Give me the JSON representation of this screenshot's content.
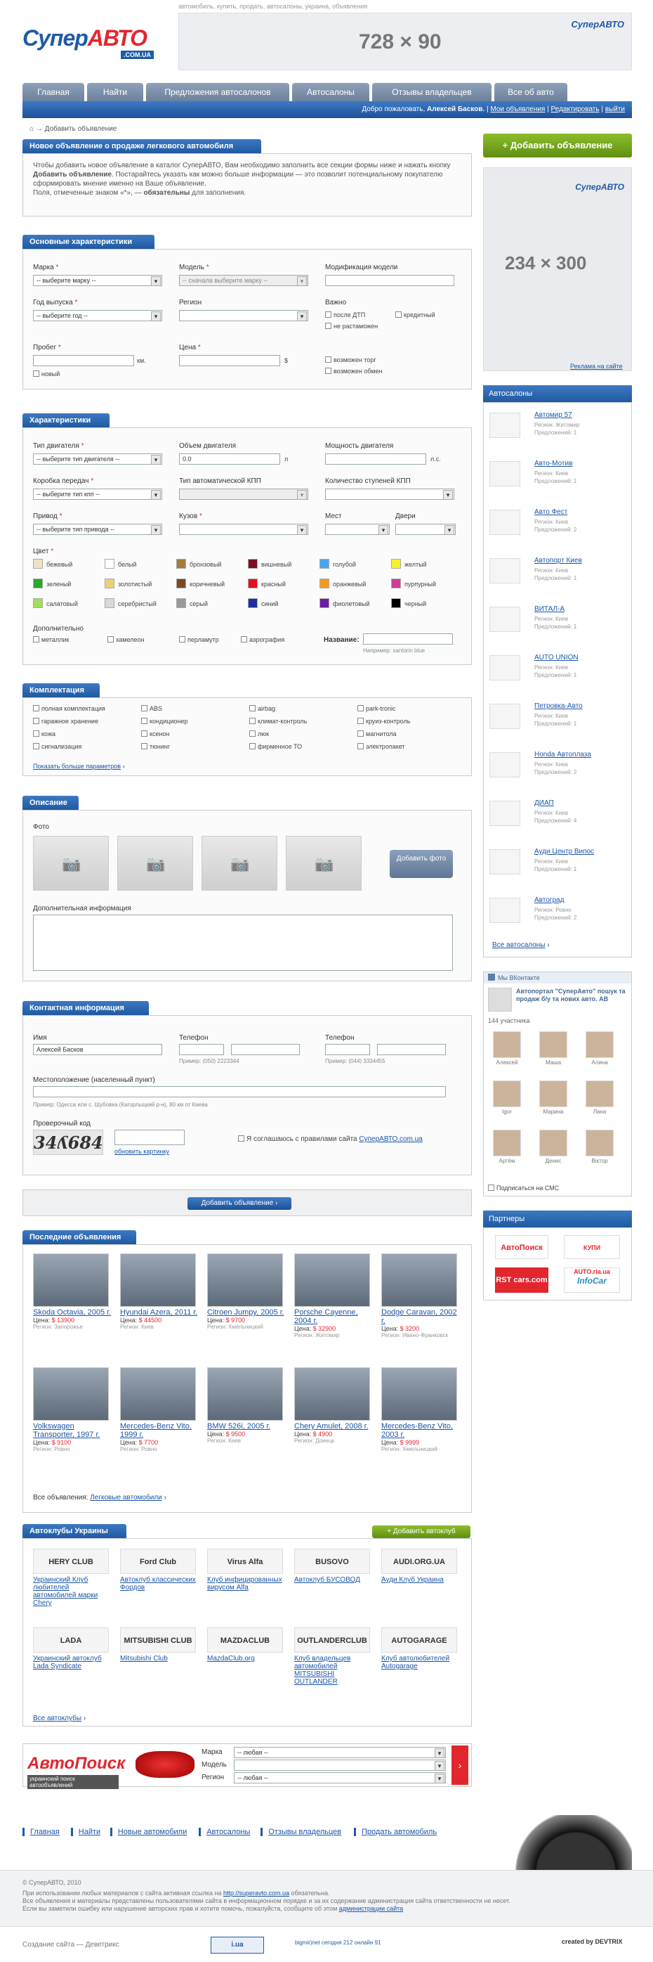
{
  "header": {
    "tagline": "автомобиль, купить, продать, автосалоны, украина, объявления",
    "logo_main": "Супер",
    "logo_accent": "АВТО",
    "logo_domain": ".COM.UA",
    "banner_size": "728 × 90",
    "banner_logo": "СуперАВТО"
  },
  "nav": {
    "tabs": [
      "Главная",
      "Найти",
      "Предложения автосалонов",
      "Автосалоны",
      "Отзывы владельцев",
      "Все об авто"
    ],
    "welcome": "Добро пожаловать,",
    "user": "Алексей Басков.",
    "my_ads": "Мои объявления",
    "edit": "Редактировать",
    "logout": "выйти"
  },
  "breadcrumb": "→ Добавить объявление",
  "intro": {
    "title": "Новое объявление о продаже легкового автомобиля",
    "text1": "Чтобы добавить новое объявление в каталог СуперАВТО, Вам необходимо заполнить все секции формы ниже и нажать кнопку",
    "button_ref": "Добавить объявление",
    "text2": ". Постарайтесь указать как можно больше информации — это позволит потенциальному покупателю сформировать мнение именно на Ваше объявление.",
    "text3": "Поля, отмеченные знаком «*», —",
    "text3b": "обязательны",
    "text3c": "для заполнения."
  },
  "sidebar_btn": "+ Добавить объявление",
  "ad_right": {
    "size": "234 × 300",
    "link": "Реклама на сайте"
  },
  "basic": {
    "title": "Основные характеристики",
    "brand": "Марка",
    "brand_val": "-- выберите марку --",
    "model": "Модель",
    "model_val": "-- сначала выберите марку --",
    "mod": "Модификация модели",
    "year": "Год выпуска",
    "year_val": "-- выберите год --",
    "region": "Регион",
    "important": "Важно",
    "imp": [
      "после ДТП",
      "кредитный",
      "не растаможен"
    ],
    "mileage": "Пробег",
    "km": "км.",
    "new": "новый",
    "price": "Цена",
    "usd": "$",
    "bargain": "возможен торг",
    "exchange": "возможен обмен"
  },
  "specs": {
    "title": "Характеристики",
    "body": "Тип двигателя",
    "body_val": "-- выберите тип двигателя --",
    "vol": "Объем двигателя",
    "vol_val": "0.0",
    "l": "л",
    "power": "Мощность двигателя",
    "hp": "л.с.",
    "gear": "Коробка передач",
    "gear_val": "-- выберите тип кпп --",
    "auto": "Тип автоматической КПП",
    "steps": "Количество ступеней КПП",
    "drive": "Привод",
    "drive_val": "-- выберите тип привода --",
    "kuzov": "Кузов",
    "seats": "Мест",
    "doors": "Двери",
    "color": "Цвет",
    "colors": [
      [
        "бежевый",
        "#efe3c4"
      ],
      [
        "белый",
        "#ffffff"
      ],
      [
        "бронзовый",
        "#a97b3c"
      ],
      [
        "вишневый",
        "#7a1020"
      ],
      [
        "голубой",
        "#4aa3f0"
      ],
      [
        "желтый",
        "#f6f12a"
      ],
      [
        "зеленый",
        "#2aa82a"
      ],
      [
        "золотистый",
        "#efd070"
      ],
      [
        "коричневый",
        "#7a4a20"
      ],
      [
        "красный",
        "#e3121e"
      ],
      [
        "оранжевый",
        "#f39a1e"
      ],
      [
        "пурпурный",
        "#d03b9a"
      ],
      [
        "салатовый",
        "#9fe05a"
      ],
      [
        "серебристый",
        "#d8d8d8"
      ],
      [
        "серый",
        "#999999"
      ],
      [
        "синий",
        "#1c2fa0"
      ],
      [
        "фиолетовый",
        "#6a1fa0"
      ],
      [
        "черный",
        "#000000"
      ]
    ],
    "extra": "Дополнительно",
    "extras": [
      "металлик",
      "хамелеон",
      "перламутр",
      "аэрография"
    ],
    "name": "Название:",
    "example": "Например: santorin blue"
  },
  "equip": {
    "title": "Комплектация",
    "items": [
      "полная комплектация",
      "ABS",
      "airbag",
      "park-tronic",
      "гаражное хранение",
      "кондиционер",
      "климат-контроль",
      "круиз-контроль",
      "кожа",
      "ксенон",
      "люк",
      "магнитола",
      "сигнализация",
      "тюнинг",
      "фирменное ТО",
      "электропакет"
    ],
    "more": "Показать больше параметров"
  },
  "desc": {
    "title": "Описание",
    "photo": "Фото",
    "add_photo": "Добавить фото",
    "info": "Дополнительная информация"
  },
  "contact": {
    "title": "Контактная информация",
    "name": "Имя",
    "name_val": "Алексей Басков",
    "phone": "Телефон",
    "ex1": "Пример: (050) 2223344",
    "ex2": "Пример: (044) 3334455",
    "loc": "Местоположение (населенный пункт)",
    "loc_ex": "Пример: Одесса или с. Шубовка (Кагорлыцкий р-н), 80 км от Киева",
    "captcha": "Проверочный код",
    "captcha_img": "34ʎ684",
    "refresh": "обновить картинку",
    "agree": "Я соглашаюсь с правилами сайта",
    "agree_link": "СуперАВТО.com.ua"
  },
  "submit": "Добавить объявление ›",
  "latest": {
    "title": "Последние объявления",
    "all": "Все объявления:",
    "all_link": "Легковые автомобили",
    "price": "Цена:",
    "cars": [
      {
        "t": "Skoda Octavia, 2005 г.",
        "p": "$ 13900",
        "r": "Регион: Запорожье"
      },
      {
        "t": "Hyundai Azera, 2011 г.",
        "p": "$ 44500",
        "r": "Регион: Киев"
      },
      {
        "t": "Citroen Jumpy, 2005 г.",
        "p": "$ 9700",
        "r": "Регион: Хмельницкий"
      },
      {
        "t": "Porsche Cayenne, 2004 г.",
        "p": "$ 32900",
        "r": "Регион: Житомир"
      },
      {
        "t": "Dodge Caravan, 2002 г.",
        "p": "$ 3200",
        "r": "Регион: Ивано-Франковск"
      },
      {
        "t": "Volkswagen Transporter, 1997 г.",
        "p": "$ 9100",
        "r": "Регион: Ровно"
      },
      {
        "t": "Mercedes-Benz Vito, 1999 г.",
        "p": "$ 7700",
        "r": "Регион: Ровно"
      },
      {
        "t": "BMW 526i, 2005 г.",
        "p": "$ 9500",
        "r": "Регион: Киев"
      },
      {
        "t": "Chery Amulet, 2008 г.",
        "p": "$ 4900",
        "r": "Регион: Донецк"
      },
      {
        "t": "Mercedes-Benz Vito, 2003 г.",
        "p": "$ 9999",
        "r": "Регион: Хмельницкий"
      }
    ]
  },
  "clubs": {
    "title": "Автоклубы Украины",
    "add": "+ Добавить автоклуб",
    "all": "Все автоклубы",
    "items": [
      {
        "logo": "HERY CLUB",
        "t": "Украинский Клуб любителей автомобилей марки Chery"
      },
      {
        "logo": "Ford Club",
        "t": "Автоклуб классических Фордов"
      },
      {
        "logo": "Virus Alfa",
        "t": "Клуб инфицированных вирусом Alfa"
      },
      {
        "logo": "BUSOVO",
        "t": "Автоклуб БУСОВОД"
      },
      {
        "logo": "AUDI.ORG.UA",
        "t": "Ауди Клуб Украина"
      },
      {
        "logo": "LADA",
        "t": "Украинский автоклуб Lada Syndicate"
      },
      {
        "logo": "MITSUBISHI CLUB",
        "t": "Mitsubishi Club"
      },
      {
        "logo": "MAZDACLUB",
        "t": "MazdaClub.org"
      },
      {
        "logo": "OUTLANDERCLUB",
        "t": "Клуб владельцев автомобилей MITSUBISHI OUTLANDER"
      },
      {
        "logo": "AUTOGARAGE",
        "t": "Клуб автолюбителей Autogarage"
      }
    ]
  },
  "search": {
    "logo": "АвтоПоиск",
    "sub": "украинский поиск автообъявлений",
    "make": "Марка",
    "model": "Модель",
    "region": "Регион",
    "any": "-- любая --"
  },
  "dealers": {
    "title": "Автосалоны",
    "all": "Все автосалоны",
    "items": [
      {
        "n": "Автомир 57",
        "r": "Регион: Житомир",
        "c": "Предложений: 1"
      },
      {
        "n": "Авто-Мотив",
        "r": "Регион: Киев",
        "c": "Предложений: 1"
      },
      {
        "n": "Авто Фест",
        "r": "Регион: Киев",
        "c": "Предложений: 2"
      },
      {
        "n": "Автопорт Киев",
        "r": "Регион: Киев",
        "c": "Предложений: 1"
      },
      {
        "n": "ВИТАЛ-А",
        "r": "Регион: Киев",
        "c": "Предложений: 1"
      },
      {
        "n": "AUTO UNION",
        "r": "Регион: Киев",
        "c": "Предложений: 1"
      },
      {
        "n": "Петровка-Авто",
        "r": "Регион: Киев",
        "c": "Предложений: 1"
      },
      {
        "n": "Honda Автоплаза",
        "r": "Регион: Киев",
        "c": "Предложений: 2"
      },
      {
        "n": "ДИАП",
        "r": "Регион: Киев",
        "c": "Предложений: 4"
      },
      {
        "n": "Ауди Центр Випос",
        "r": "Регион: Киев",
        "c": "Предложений: 1"
      },
      {
        "n": "Автоград",
        "r": "Регион: Ровно",
        "c": "Предложений: 2"
      }
    ]
  },
  "vk": {
    "title": "Мы ВКонтакте",
    "group": "Автопортал \"СуперАвто\" пошук та продаж б/у та нових авто. АВ",
    "count": "144 участника",
    "friends": [
      "Алексей",
      "Маша",
      "Алина",
      "Igor",
      "Марина",
      "Лана",
      "Артём",
      "Денис",
      "Віктор"
    ],
    "sms": "Подписаться на СМС"
  },
  "partners": {
    "title": "Партнеры",
    "items": [
      "АвтоПоиск",
      "КУПИ AUTO.ria.ua",
      "RST cars.com",
      "InfoCar"
    ]
  },
  "footer": {
    "links": [
      "Главная",
      "Найти",
      "Новые автомобили",
      "Автосалоны",
      "Отзывы владельцев",
      "Продать автомобиль"
    ],
    "copy": "© СуперАВТО, 2010",
    "l1": "При использовании любых материалов с сайта активная ссылка на",
    "l1link": "http://superavto.com.ua",
    "l1b": "обязательна.",
    "l2": "Все объявления и материалы представлены пользователями сайта в информационном порядке и за их содержание администрация сайта ответственности не несет.",
    "l3": "Если вы заметили ошибку или нарушение авторских прав и хотите помочь, пожалуйста, сообщите об этом",
    "l3link": "администрации сайта",
    "made": "Создание сайта — Деветрикс",
    "counter1": "bigmir)net",
    "counter2": "сегодня 212 онлайн 91",
    "created": "created by DEVTRIX"
  }
}
